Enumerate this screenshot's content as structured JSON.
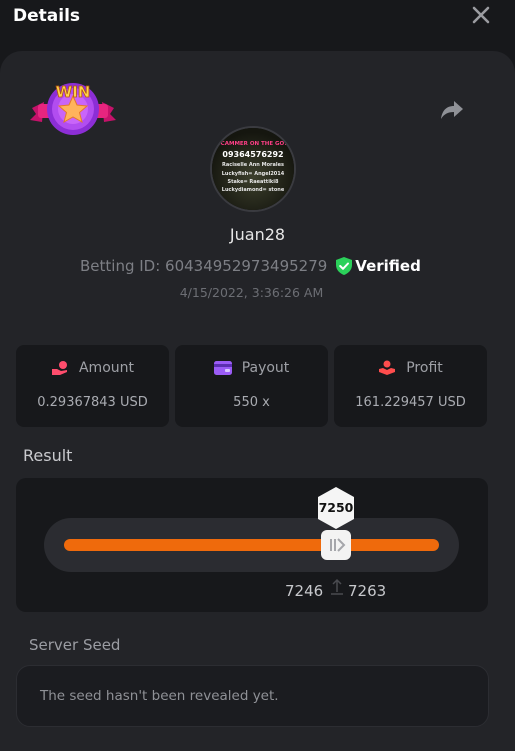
{
  "header": {
    "title": "Details",
    "close_icon": "close-icon"
  },
  "badge": {
    "text": "WIN",
    "icon": "win-star-badge"
  },
  "share_icon": "share-arrow-icon",
  "avatar": {
    "lines": [
      "SCAMMER ON THE GO!!",
      "09364576292",
      "Raciselle Ann Morales",
      "Luckyfish= Angel2014",
      "Stake= Raeattiki8",
      "Luckydiamond= stone"
    ]
  },
  "user": {
    "name": "Juan28",
    "betting_id": "Betting ID: 60434952973495279",
    "verified_label": "Verified",
    "date": "4/15/2022, 3:36:26 AM"
  },
  "stats": {
    "amount": {
      "label": "Amount",
      "value": "0.29367843 USD",
      "icon": "coins-hand-icon"
    },
    "payout": {
      "label": "Payout",
      "value": "550 x",
      "icon": "wallet-icon"
    },
    "profit": {
      "label": "Profit",
      "value": "161.229457 USD",
      "icon": "profit-hand-icon"
    }
  },
  "result": {
    "label": "Result",
    "value": "7250",
    "range_low": "7246",
    "range_high": "7263"
  },
  "server_seed": {
    "label": "Server Seed",
    "text": "The seed hasn't been revealed yet."
  },
  "colors": {
    "accent_orange": "#ef6a0c",
    "verified_green": "#2bd15a",
    "background": "#17181b",
    "card": "#232428"
  }
}
